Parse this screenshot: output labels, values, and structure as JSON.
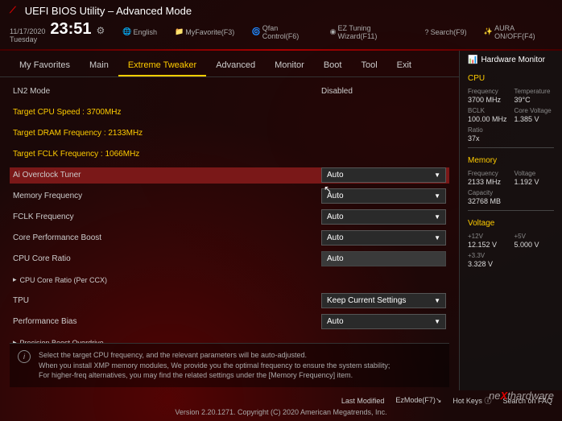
{
  "header": {
    "logo": "REPUBLIC OF GAMERS",
    "title": "UEFI BIOS Utility – Advanced Mode",
    "date": "11/17/2020",
    "day": "Tuesday",
    "time": "23:51",
    "toolbar": {
      "language": "English",
      "favorite": "MyFavorite(F3)",
      "qfan": "Qfan Control(F6)",
      "ezwizard": "EZ Tuning Wizard(F11)",
      "search": "Search(F9)",
      "aura": "AURA ON/OFF(F4)"
    }
  },
  "tabs": [
    "My Favorites",
    "Main",
    "Extreme Tweaker",
    "Advanced",
    "Monitor",
    "Boot",
    "Tool",
    "Exit"
  ],
  "active_tab": 2,
  "settings": {
    "ln2_mode": {
      "label": "LN2 Mode",
      "value": "Disabled"
    },
    "target_cpu": "Target CPU Speed : 3700MHz",
    "target_dram": "Target DRAM Frequency : 2133MHz",
    "target_fclk": "Target FCLK Frequency : 1066MHz",
    "ai_overclock": {
      "label": "Ai Overclock Tuner",
      "value": "Auto"
    },
    "mem_freq": {
      "label": "Memory Frequency",
      "value": "Auto"
    },
    "fclk_freq": {
      "label": "FCLK Frequency",
      "value": "Auto"
    },
    "core_boost": {
      "label": "Core Performance Boost",
      "value": "Auto"
    },
    "cpu_core_ratio": {
      "label": "CPU Core Ratio",
      "value": "Auto"
    },
    "cpu_core_ratio_ccx": "CPU Core Ratio (Per CCX)",
    "tpu": {
      "label": "TPU",
      "value": "Keep Current Settings"
    },
    "perf_bias": {
      "label": "Performance Bias",
      "value": "Auto"
    },
    "precision_boost": "Precision Boost Overdrive"
  },
  "help": {
    "line1": "Select the target CPU frequency, and the relevant parameters will be auto-adjusted.",
    "line2": "When you install XMP memory modules, We provide you the optimal frequency to ensure the system stability;",
    "line3": "For higher-freq alternatives, you may find the related settings under the [Memory Frequency] item."
  },
  "sidebar": {
    "title": "Hardware Monitor",
    "cpu": {
      "heading": "CPU",
      "freq_lbl": "Frequency",
      "freq": "3700 MHz",
      "temp_lbl": "Temperature",
      "temp": "39°C",
      "bclk_lbl": "BCLK",
      "bclk": "100.00 MHz",
      "cv_lbl": "Core Voltage",
      "cv": "1.385 V",
      "ratio_lbl": "Ratio",
      "ratio": "37x"
    },
    "memory": {
      "heading": "Memory",
      "freq_lbl": "Frequency",
      "freq": "2133 MHz",
      "volt_lbl": "Voltage",
      "volt": "1.192 V",
      "cap_lbl": "Capacity",
      "cap": "32768 MB"
    },
    "voltage": {
      "heading": "Voltage",
      "v12_lbl": "+12V",
      "v12": "12.152 V",
      "v5_lbl": "+5V",
      "v5": "5.000 V",
      "v33_lbl": "+3.3V",
      "v33": "3.328 V"
    }
  },
  "footer": {
    "last_modified": "Last Modified",
    "ezmode": "EzMode(F7)",
    "hotkeys": "Hot Keys",
    "search_faq": "Search on FAQ",
    "version": "Version 2.20.1271. Copyright (C) 2020 American Megatrends, Inc."
  },
  "watermark": "nexthardware"
}
